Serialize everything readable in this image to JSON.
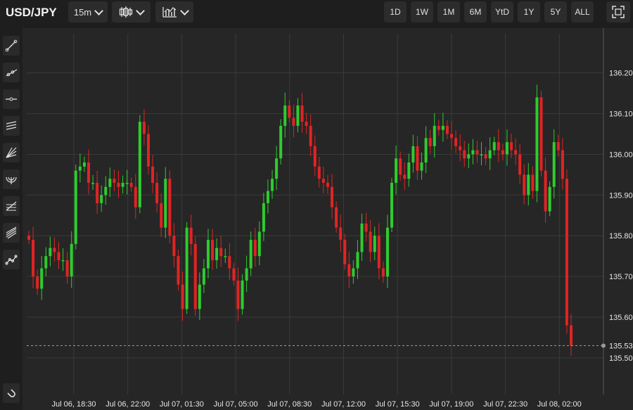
{
  "toolbar": {
    "symbol": "USD/JPY",
    "interval": "15m",
    "ranges": [
      "1D",
      "1W",
      "1M",
      "6M",
      "YtD",
      "1Y",
      "5Y",
      "ALL"
    ]
  },
  "sidebar": {
    "tools": [
      "trend-line-icon",
      "ray-icon",
      "horizontal-line-icon",
      "parallel-channel-icon",
      "fan-icon",
      "arc-icon",
      "fib-retracement-icon",
      "pitchfork-icon",
      "path-icon"
    ],
    "bottom_tool": "magnet-icon"
  },
  "colors": {
    "up": "#2ecc2e",
    "down": "#e02424",
    "grid": "#3a3a3a",
    "background": "#262626"
  },
  "chart_data": {
    "type": "candlestick",
    "title": "USD/JPY",
    "ylim": [
      135.41,
      136.31
    ],
    "yticks": [
      135.5,
      135.6,
      135.7,
      135.8,
      135.9,
      136.0,
      136.1,
      136.2
    ],
    "ytick_labels": [
      "135.50",
      "135.60",
      "135.70",
      "135.80",
      "135.90",
      "136.00",
      "136.10",
      "136.20"
    ],
    "last_price": 135.53,
    "last_price_label": "135.53",
    "x_tick_labels": [
      "Jul 06, 18:30",
      "Jul 06, 22:00",
      "Jul 07, 01:30",
      "Jul 07, 05:00",
      "Jul 07, 08:30",
      "Jul 07, 12:00",
      "Jul 07, 15:30",
      "Jul 07, 19:00",
      "Jul 07, 22:30",
      "Jul 08, 02:00"
    ],
    "grid": true,
    "closes": [
      135.79,
      135.7,
      135.67,
      135.72,
      135.75,
      135.77,
      135.76,
      135.74,
      135.74,
      135.7,
      135.78,
      135.96,
      135.97,
      135.98,
      135.93,
      135.93,
      135.88,
      135.9,
      135.92,
      135.94,
      135.93,
      135.92,
      135.93,
      135.93,
      135.92,
      135.87,
      136.08,
      136.05,
      135.97,
      135.93,
      135.88,
      135.82,
      135.94,
      135.8,
      135.75,
      135.68,
      135.62,
      135.82,
      135.78,
      135.62,
      135.68,
      135.72,
      135.79,
      135.74,
      135.77,
      135.75,
      135.75,
      135.72,
      135.69,
      135.62,
      135.69,
      135.72,
      135.79,
      135.75,
      135.81,
      135.88,
      135.91,
      135.94,
      135.99,
      136.07,
      136.12,
      136.09,
      136.07,
      136.12,
      136.08,
      136.07,
      136.02,
      135.97,
      135.94,
      135.93,
      135.92,
      135.87,
      135.82,
      135.79,
      135.73,
      135.7,
      135.72,
      135.76,
      135.83,
      135.81,
      135.76,
      135.8,
      135.72,
      135.7,
      135.82,
      135.93,
      135.99,
      135.95,
      135.94,
      135.98,
      136.02,
      135.96,
      135.98,
      136.04,
      136.02,
      136.07,
      136.06,
      136.07,
      136.05,
      136.04,
      136.02,
      136.01,
      135.99,
      136.0,
      136.01,
      136.0,
      136.0,
      135.99,
      136.01,
      136.03,
      136.01,
      136.0,
      136.03,
      136.01,
      136.0,
      135.95,
      135.9,
      135.95,
      135.91,
      136.14,
      135.96,
      135.86,
      135.92,
      136.03,
      136.01,
      135.94,
      135.58,
      135.53
    ]
  }
}
